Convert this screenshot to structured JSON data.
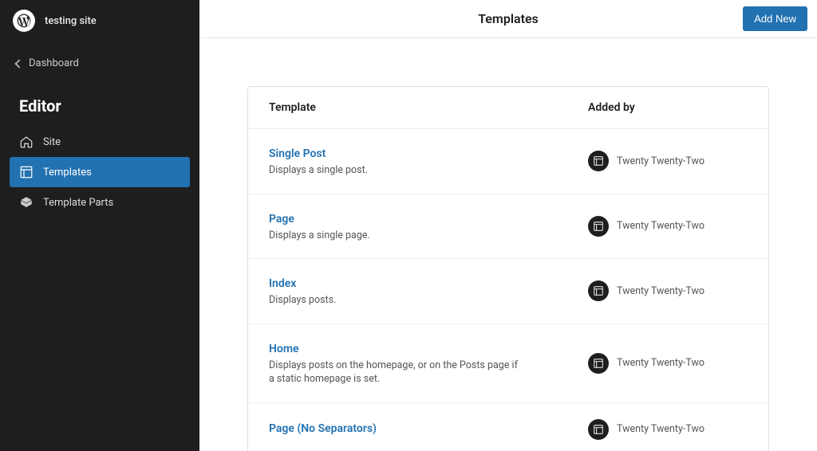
{
  "sidebar": {
    "site_title": "testing site",
    "back_label": "Dashboard",
    "heading": "Editor",
    "nav": [
      {
        "label": "Site",
        "icon": "home-icon",
        "active": false
      },
      {
        "label": "Templates",
        "icon": "layout-icon",
        "active": true
      },
      {
        "label": "Template Parts",
        "icon": "symbol-icon",
        "active": false
      }
    ]
  },
  "header": {
    "title": "Templates",
    "add_new_label": "Add New"
  },
  "table": {
    "col_template": "Template",
    "col_added_by": "Added by"
  },
  "templates": [
    {
      "name": "Single Post",
      "description": "Displays a single post.",
      "added_by": "Twenty Twenty-Two"
    },
    {
      "name": "Page",
      "description": "Displays a single page.",
      "added_by": "Twenty Twenty-Two"
    },
    {
      "name": "Index",
      "description": "Displays posts.",
      "added_by": "Twenty Twenty-Two"
    },
    {
      "name": "Home",
      "description": "Displays posts on the homepage, or on the Posts page if a static homepage is set.",
      "added_by": "Twenty Twenty-Two"
    },
    {
      "name": "Page (No Separators)",
      "description": "",
      "added_by": "Twenty Twenty-Two"
    }
  ]
}
